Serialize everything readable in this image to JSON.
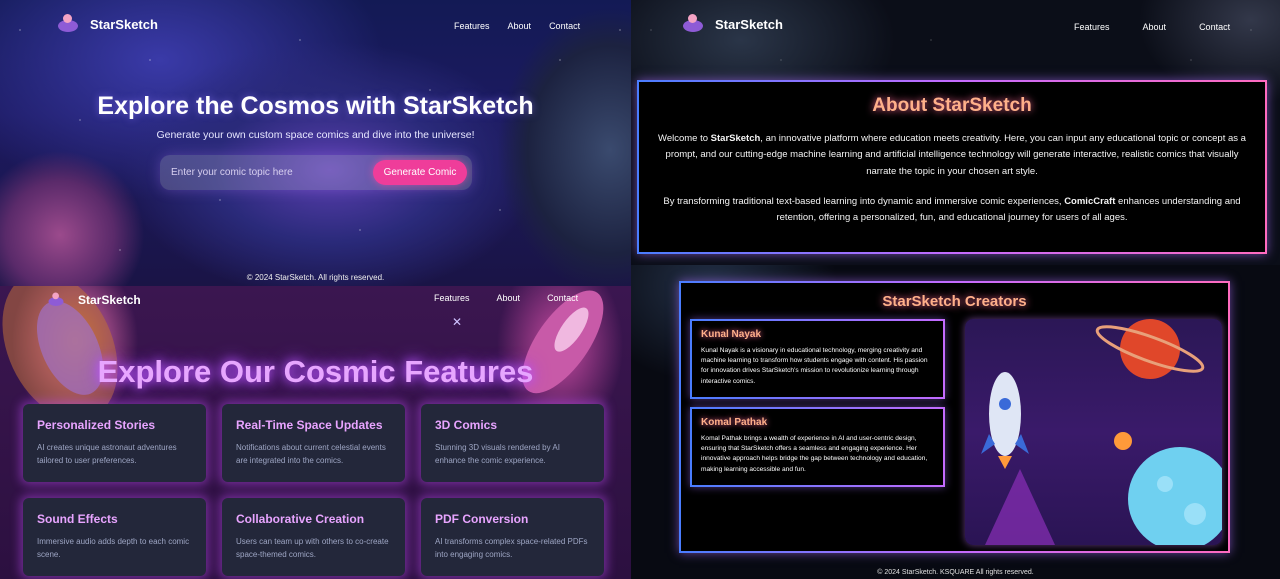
{
  "brand": "StarSketch",
  "nav": {
    "features": "Features",
    "about": "About",
    "contact": "Contact"
  },
  "home": {
    "title": "Explore the Cosmos with StarSketch",
    "subtitle": "Generate your own custom space comics and dive into the universe!",
    "input_placeholder": "Enter your comic topic here",
    "button": "Generate Comic",
    "footer": "© 2024 StarSketch. All rights reserved."
  },
  "features": {
    "title": "Explore Our Cosmic Features",
    "cards": [
      {
        "title": "Personalized Stories",
        "desc": "AI creates unique astronaut adventures tailored to user preferences."
      },
      {
        "title": "Real-Time Space Updates",
        "desc": "Notifications about current celestial events are integrated into the comics."
      },
      {
        "title": "3D Comics",
        "desc": "Stunning 3D visuals rendered by AI enhance the comic experience."
      },
      {
        "title": "Sound Effects",
        "desc": "Immersive audio adds depth to each comic scene."
      },
      {
        "title": "Collaborative Creation",
        "desc": "Users can team up with others to co-create space-themed comics."
      },
      {
        "title": "PDF Conversion",
        "desc": "AI transforms complex space-related PDFs into engaging comics."
      }
    ]
  },
  "about": {
    "title": "About StarSketch",
    "p1_a": "Welcome to ",
    "p1_b": "StarSketch",
    "p1_c": ", an innovative platform where education meets creativity. Here, you can input any educational topic or concept as a prompt, and our cutting-edge machine learning and artificial intelligence technology will generate interactive, realistic comics that visually narrate the topic in your chosen art style.",
    "p2_a": "By transforming traditional text-based learning into dynamic and immersive comic experiences, ",
    "p2_b": "ComicCraft",
    "p2_c": " enhances understanding and retention, offering a personalized, fun, and educational journey for users of all ages."
  },
  "creators": {
    "title": "StarSketch Creators",
    "people": [
      {
        "name": "Kunal Nayak",
        "bio": "Kunal Nayak is a visionary in educational technology, merging creativity and machine learning to transform how students engage with content. His passion for innovation drives StarSketch's mission to revolutionize learning through interactive comics."
      },
      {
        "name": "Komal Pathak",
        "bio": "Komal Pathak brings a wealth of experience in AI and user-centric design, ensuring that StarSketch offers a seamless and engaging experience. Her innovative approach helps bridge the gap between technology and education, making learning accessible and fun."
      }
    ],
    "footer": "© 2024 StarSketch. KSQUARE All rights reserved."
  },
  "icons": [
    "logo-icon",
    "rocket-icon",
    "planet-icon",
    "star-icon"
  ]
}
